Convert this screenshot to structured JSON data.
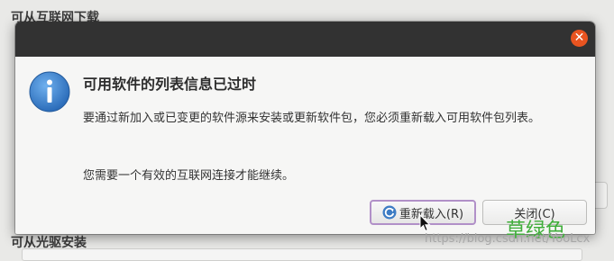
{
  "background": {
    "section_title": "可从互联网下载",
    "section_title2": "可从光驱安装"
  },
  "dialog": {
    "heading": "可用软件的列表信息已过时",
    "message": "要通过新加入或已变更的软件源来安装或更新软件包，您必须重新载入可用软件包列表。",
    "message2": "您需要一个有效的互联网连接才能继续。",
    "reload_label": "重新载入(R)",
    "close_label": "关闭(C)",
    "close_glyph": "✕"
  },
  "watermark": {
    "text": "草绿色",
    "url": "https://blog.csdn.net/YooLcx"
  },
  "colors": {
    "titlebar": "#323232",
    "close": "#e95420",
    "info": "#3a7dc9",
    "focus": "#b190c8",
    "watermark": "#3fae3a"
  }
}
